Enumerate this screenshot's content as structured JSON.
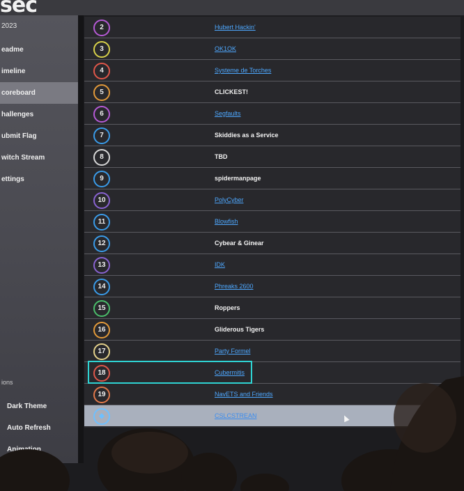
{
  "app": {
    "brand": "sec"
  },
  "sidebar": {
    "year": "2023",
    "items": [
      {
        "label": "eadme",
        "active": false
      },
      {
        "label": "imeline",
        "active": false
      },
      {
        "label": "coreboard",
        "active": true
      },
      {
        "label": "hallenges",
        "active": false
      },
      {
        "label": "ubmit Flag",
        "active": false
      },
      {
        "label": "witch Stream",
        "active": false
      },
      {
        "label": "ettings",
        "active": false
      }
    ],
    "options_header": "ions",
    "options": {
      "dark_theme": "Dark Theme",
      "auto_refresh": "Auto Refresh",
      "animation": "Animation"
    }
  },
  "scoreboard": {
    "rows": [
      {
        "rank": "2",
        "team": "Hubert Hackin'",
        "link": true,
        "color": "#b65ad6"
      },
      {
        "rank": "3",
        "team": "OK1OK",
        "link": true,
        "color": "#d9d24a"
      },
      {
        "rank": "4",
        "team": "Systeme de Torches",
        "link": true,
        "color": "#e0574a"
      },
      {
        "rank": "5",
        "team": "CLICKEST!",
        "link": false,
        "color": "#e39a3a"
      },
      {
        "rank": "6",
        "team": "Segfaults",
        "link": true,
        "color": "#b65ad6"
      },
      {
        "rank": "7",
        "team": "Skiddies as a Service",
        "link": false,
        "color": "#3a9cea"
      },
      {
        "rank": "8",
        "team": "TBD",
        "link": false,
        "color": "#d8d8d8"
      },
      {
        "rank": "9",
        "team": "spidermanpage",
        "link": false,
        "color": "#3a9cea"
      },
      {
        "rank": "10",
        "team": "PolyCyber",
        "link": true,
        "color": "#8a63d2"
      },
      {
        "rank": "11",
        "team": "Blowfish",
        "link": true,
        "color": "#3a9cea"
      },
      {
        "rank": "12",
        "team": "Cybear & Ginear",
        "link": false,
        "color": "#3a9cea"
      },
      {
        "rank": "13",
        "team": "IDK",
        "link": true,
        "color": "#8a63d2"
      },
      {
        "rank": "14",
        "team": "Phreaks 2600",
        "link": true,
        "color": "#3a9cea"
      },
      {
        "rank": "15",
        "team": "Roppers",
        "link": false,
        "color": "#4bbf6b"
      },
      {
        "rank": "16",
        "team": "Gliderous Tigers",
        "link": false,
        "color": "#e39a3a"
      },
      {
        "rank": "17",
        "team": "Party Formel",
        "link": true,
        "color": "#e3d08a"
      },
      {
        "rank": "18",
        "team": "Cubermitis",
        "link": true,
        "color": "#e0574a"
      },
      {
        "rank": "19",
        "team": "NavETS and Friends",
        "link": true,
        "color": "#e0784a"
      }
    ],
    "current": {
      "team": "CSLCSTREAN",
      "icon": "team-icon",
      "link": true
    },
    "highlight_rank": "18"
  },
  "colors": {
    "highlight": "#2fd3d3",
    "link": "#4ea8ff"
  }
}
